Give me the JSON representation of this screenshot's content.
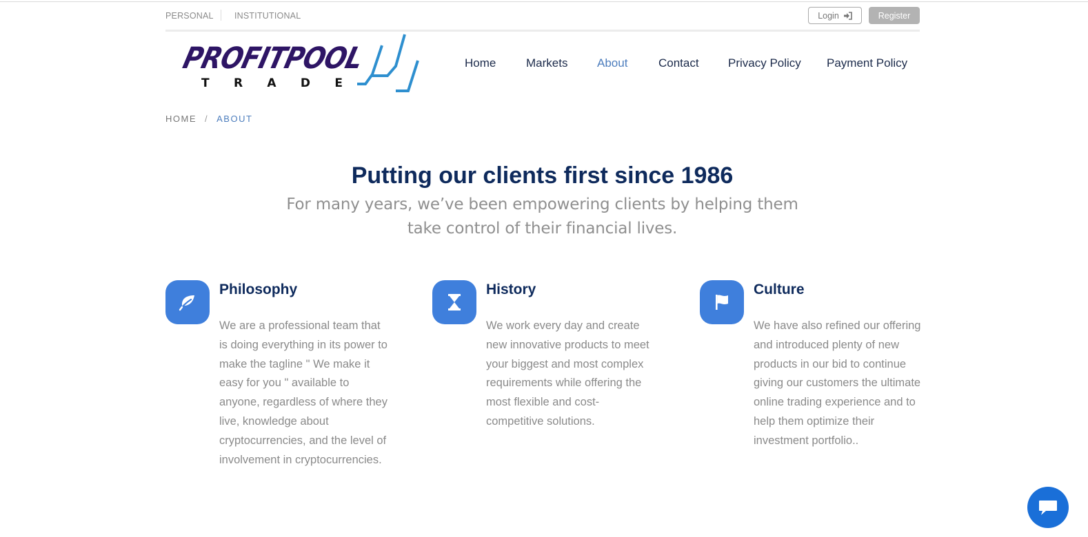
{
  "topbar": {
    "personal": "PERSONAL",
    "institutional": "INSTITUTIONAL",
    "login_label": "Login",
    "register_label": "Register"
  },
  "logo": {
    "wordmark": "PROFITPOOL",
    "subword": "TRADE"
  },
  "nav": {
    "items": [
      {
        "label": "Home",
        "active": false
      },
      {
        "label": "Markets",
        "active": false
      },
      {
        "label": "About",
        "active": true
      },
      {
        "label": "Contact",
        "active": false
      },
      {
        "label": "Privacy Policy",
        "active": false
      },
      {
        "label": "Payment Policy",
        "active": false
      }
    ]
  },
  "breadcrumb": {
    "home": "HOME",
    "separator": "/",
    "current": "ABOUT"
  },
  "hero": {
    "title": "Putting our clients first since 1986",
    "subtitle": "For many years, we’ve been empowering clients by helping them take control of their financial lives."
  },
  "features": [
    {
      "icon": "leaf-icon",
      "title": "Philosophy",
      "text": "We are a professional team that is doing everything in its power to make the tagline \" We make it easy for you \" available to anyone, regardless of where they live, knowledge about cryptocurrencies, and the level of involvement in cryptocurrencies."
    },
    {
      "icon": "hourglass-icon",
      "title": "History",
      "text": "We work every day and create new innovative products to meet your biggest and most complex requirements while offering the most flexible and cost-competitive solutions."
    },
    {
      "icon": "flag-icon",
      "title": "Culture",
      "text": "We have also refined our offering and introduced plenty of new products in our bid to continue giving our customers the ultimate online trading experience and to help them optimize their investment portfolio.."
    }
  ],
  "colors": {
    "accent": "#3f7fdc",
    "heading": "#0e2a5c",
    "nav_active": "#4c7dbd",
    "chat": "#1a6fd8"
  }
}
